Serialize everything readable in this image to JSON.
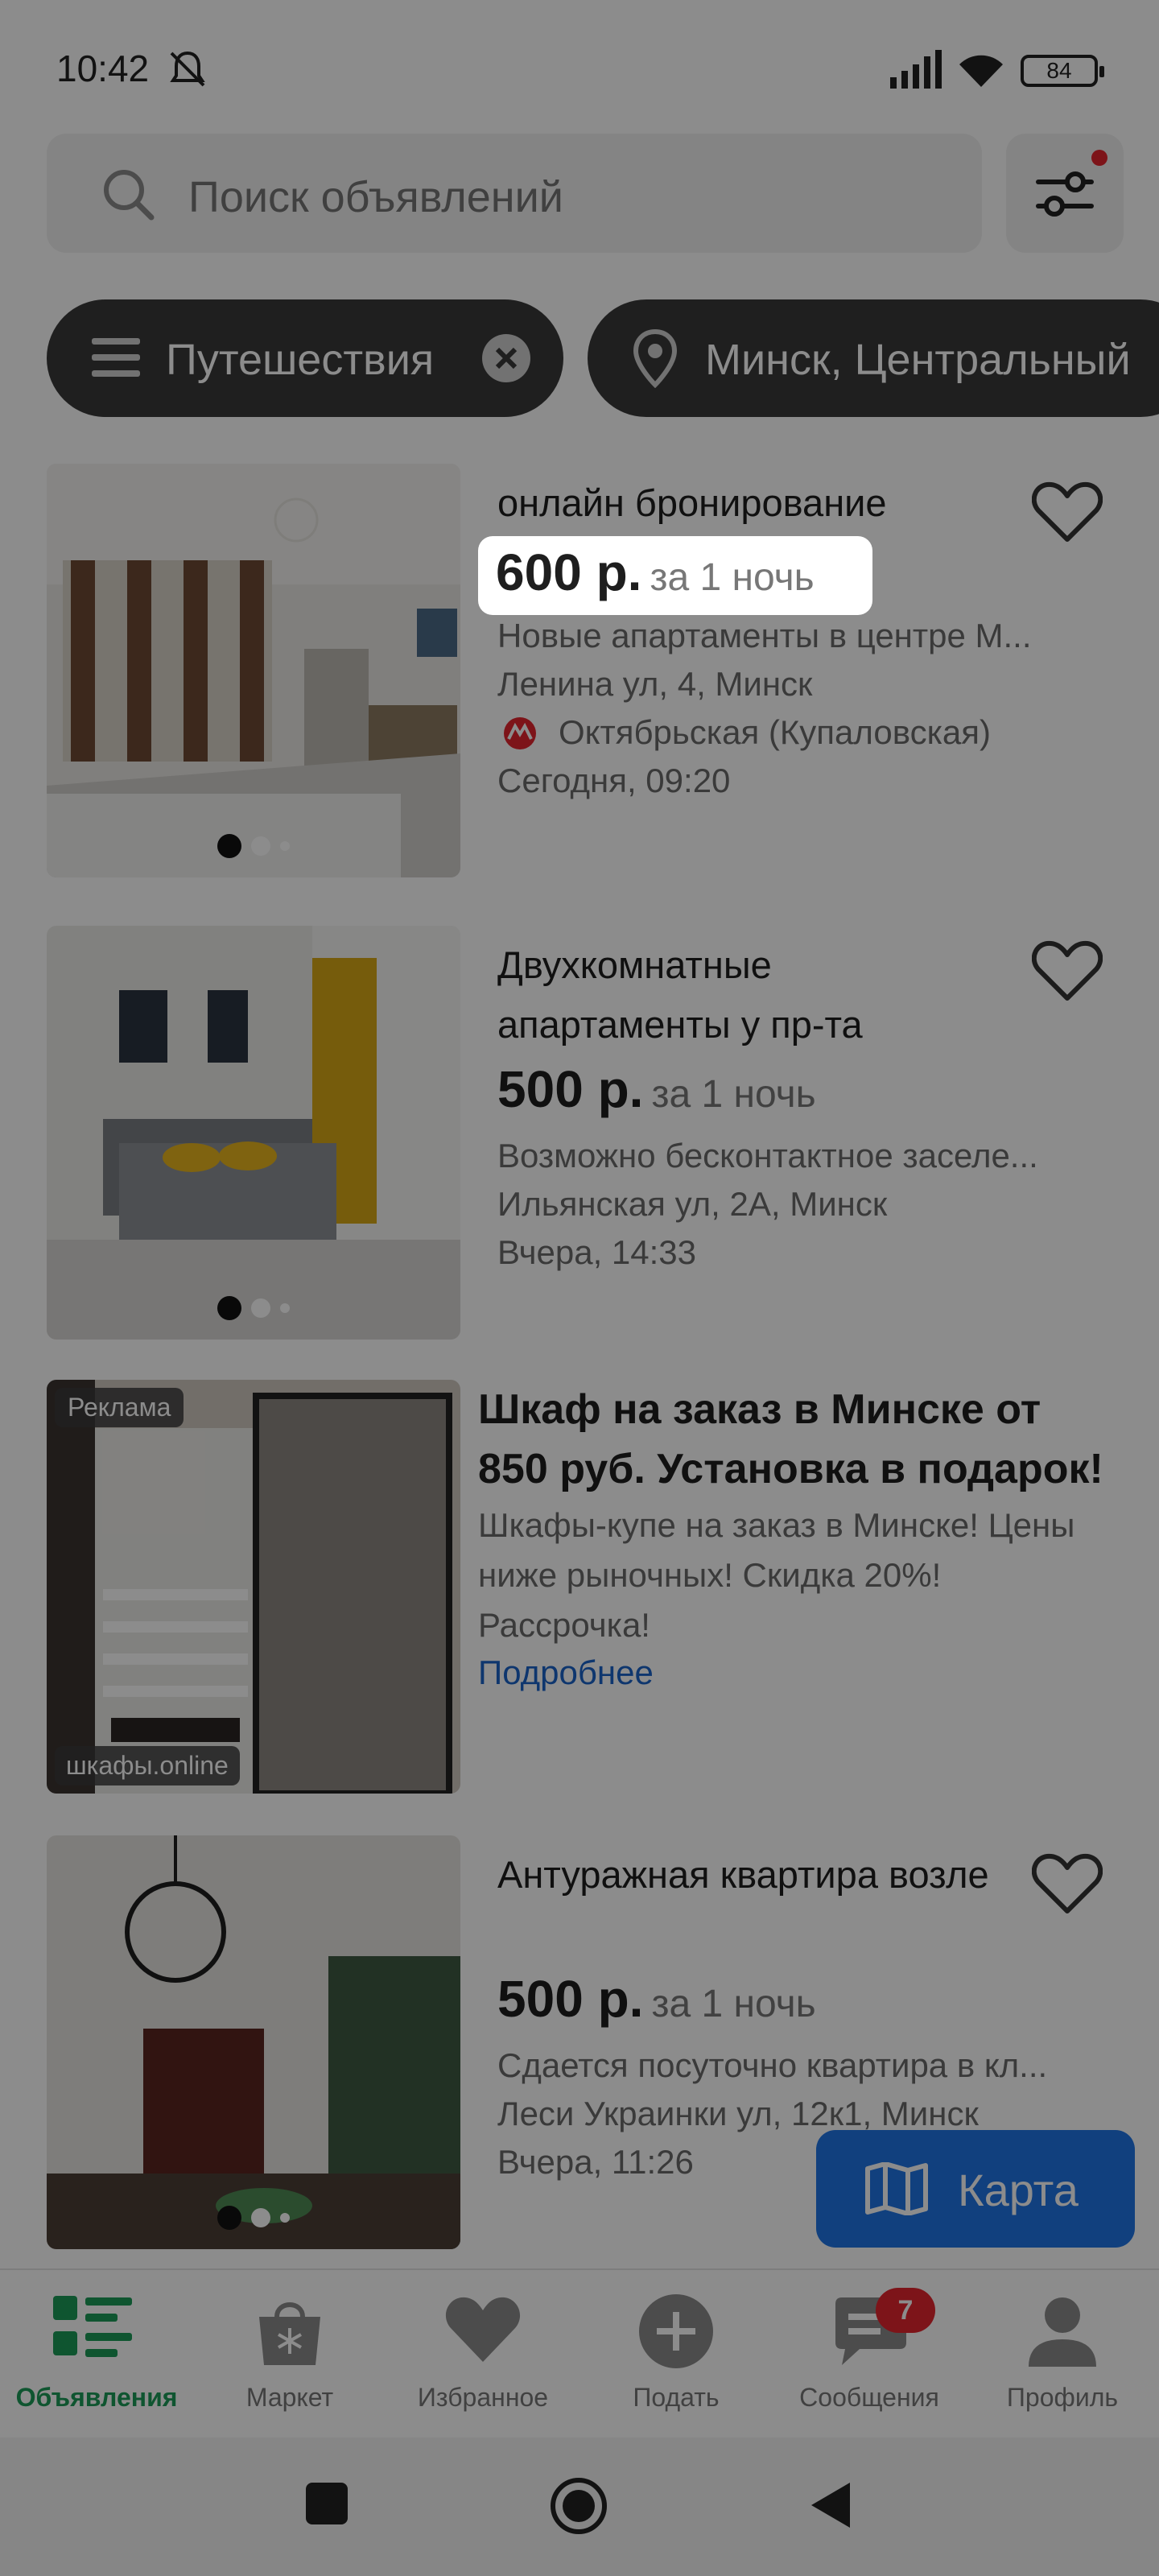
{
  "status_bar": {
    "time": "10:42",
    "battery": "84"
  },
  "search": {
    "placeholder": "Поиск объявлений"
  },
  "chips": {
    "category": "Путешествия",
    "location": "Минск, Центральный"
  },
  "listings": [
    {
      "title": "онлайн бронирование",
      "price": "600 р.",
      "per": "за 1 ночь",
      "description": "Новые апартаменты в центре М...",
      "address": "Ленина ул, 4, Минск",
      "metro": "Октябрьская (Купаловская)",
      "date": "Сегодня, 09:20"
    },
    {
      "title": "Двухкомнатные апартаменты у пр-та",
      "price": "500 р.",
      "per": "за 1 ночь",
      "description": "Возможно бесконтактное заселе...",
      "address": "Ильянская ул, 2А, Минск",
      "date": "Вчера, 14:33"
    },
    {
      "title": "Антуражная квартира возле",
      "price": "500 р.",
      "per": "за 1 ночь",
      "description": "Сдается посуточно квартира в кл...",
      "address": "Леси Украинки ул, 12к1, Минск",
      "date": "Вчера, 11:26"
    }
  ],
  "ad": {
    "badge": "Реклама",
    "source": "шкафы.online",
    "title": "Шкаф на заказ в Минске от 850 руб. Установка в подарок!",
    "text": "Шкафы-купе на заказ в Минске! Цены ниже рыночных! Скидка 20%! Рассрочка!",
    "link": "Подробнее"
  },
  "map_button": {
    "label": "Карта"
  },
  "bottom_nav": {
    "items": [
      {
        "label": "Объявления",
        "icon": "listings-icon",
        "active": true
      },
      {
        "label": "Маркет",
        "icon": "market-bag-icon"
      },
      {
        "label": "Избранное",
        "icon": "heart-icon"
      },
      {
        "label": "Подать",
        "icon": "plus-circle-icon"
      },
      {
        "label": "Сообщения",
        "icon": "chat-icon",
        "badge": "7"
      },
      {
        "label": "Профиль",
        "icon": "person-icon"
      }
    ]
  },
  "colors": {
    "accent_green": "#1c9c58",
    "map_blue": "#1f75e6",
    "link_blue": "#1a63c9",
    "badge_red": "#e3262f"
  }
}
